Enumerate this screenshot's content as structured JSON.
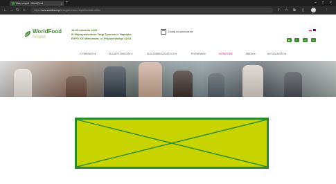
{
  "browser": {
    "tab_title": "Nasz zespół - WorldFood",
    "tab_close": "×",
    "new_tab": "+",
    "url_prefix": "https://",
    "url_host": "www.worldfood.pl",
    "url_path": "/o-targach/nasz-zespol/kontakt-online"
  },
  "header": {
    "logo_name": "WorldFood",
    "logo_country": "Poland",
    "event_line1": "18-20 kwietnia 2023",
    "event_line2": "III Międzynarodowe Targi Żywności i Napojów",
    "event_line3": "EXPO XXI Warszawa, ul. Prądzyńskiego 12/14",
    "calendar_label": "Dodaj do kalendarza"
  },
  "nav": {
    "items": [
      {
        "label": "O TARGACH ▾"
      },
      {
        "label": "DLA WYSTAWCÓW ▾"
      },
      {
        "label": "DLA ODWIEDZAJĄCYCH ▾"
      },
      {
        "label": "PROGRAM ▾"
      },
      {
        "label": "INTRATORE"
      },
      {
        "label": "MEDIA ▾"
      },
      {
        "label": "AKTUALNOŚCI ▾"
      }
    ]
  },
  "colors": {
    "brand_green": "#3d8a2a",
    "placeholder_fill": "#c8d400",
    "nav_active": "#c2185b"
  },
  "icons": {
    "social": [
      "youtube-icon",
      "facebook-icon",
      "instagram-icon",
      "linkedin-icon"
    ]
  }
}
